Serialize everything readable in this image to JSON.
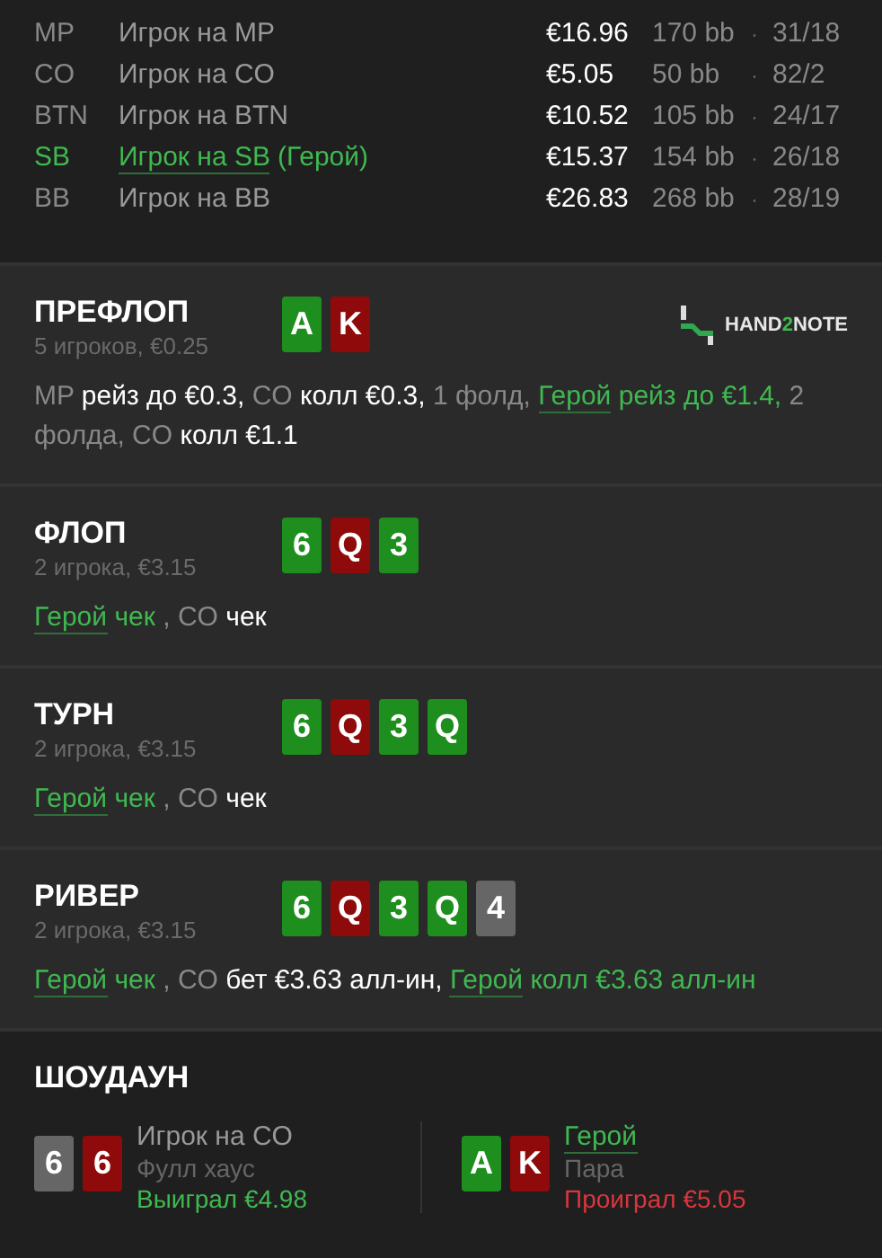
{
  "players": [
    {
      "position": "MP",
      "name": "Игрок на MP",
      "hero": false,
      "stack": "€16.96",
      "bb": "170 bb",
      "stats": "31/18"
    },
    {
      "position": "CO",
      "name": "Игрок на CO",
      "hero": false,
      "stack": "€5.05",
      "bb": "50 bb",
      "stats": "82/2"
    },
    {
      "position": "BTN",
      "name": "Игрок на BTN",
      "hero": false,
      "stack": "€10.52",
      "bb": "105 bb",
      "stats": "24/17"
    },
    {
      "position": "SB",
      "name": "Игрок на SB",
      "hero": true,
      "hero_label": "(Герой)",
      "stack": "€15.37",
      "bb": "154 bb",
      "stats": "26/18"
    },
    {
      "position": "BB",
      "name": "Игрок на BB",
      "hero": false,
      "stack": "€26.83",
      "bb": "268 bb",
      "stats": "28/19"
    }
  ],
  "separator": "·",
  "logo": {
    "prefix": "HAND",
    "accent": "2",
    "suffix": "NOTE"
  },
  "streets": [
    {
      "title": "ПРЕФЛОП",
      "info": "5 игроков, €0.25",
      "logo": true,
      "cards": [
        {
          "rank": "A",
          "color": "#1e8f1e"
        },
        {
          "rank": "K",
          "color": "#8f0a0a"
        }
      ],
      "actions": [
        {
          "kind": "player",
          "text": "MP"
        },
        {
          "kind": "action",
          "text": "рейз до €0.3,"
        },
        {
          "kind": "player",
          "text": "CO"
        },
        {
          "kind": "action",
          "text": "колл €0.3,"
        },
        {
          "kind": "player",
          "text": "1 фолд,"
        },
        {
          "kind": "hero",
          "text": "Герой"
        },
        {
          "kind": "hero_action",
          "text": "рейз до €1.4,"
        },
        {
          "kind": "player",
          "text": "2 фолда,"
        },
        {
          "kind": "player",
          "text": "CO"
        },
        {
          "kind": "action",
          "text": "колл €1.1"
        }
      ]
    },
    {
      "title": "ФЛОП",
      "info": "2 игрока, €3.15",
      "logo": false,
      "cards": [
        {
          "rank": "6",
          "color": "#1e8f1e"
        },
        {
          "rank": "Q",
          "color": "#8f0a0a"
        },
        {
          "rank": "3",
          "color": "#1e8f1e"
        }
      ],
      "actions": [
        {
          "kind": "hero",
          "text": "Герой"
        },
        {
          "kind": "hero_action",
          "text": "чек"
        },
        {
          "kind": "player",
          "text": ", CO"
        },
        {
          "kind": "action",
          "text": "чек"
        }
      ]
    },
    {
      "title": "ТУРН",
      "info": "2 игрока, €3.15",
      "logo": false,
      "cards": [
        {
          "rank": "6",
          "color": "#1e8f1e"
        },
        {
          "rank": "Q",
          "color": "#8f0a0a"
        },
        {
          "rank": "3",
          "color": "#1e8f1e"
        },
        {
          "rank": "Q",
          "color": "#1e8f1e"
        }
      ],
      "actions": [
        {
          "kind": "hero",
          "text": "Герой"
        },
        {
          "kind": "hero_action",
          "text": "чек"
        },
        {
          "kind": "player",
          "text": ", CO"
        },
        {
          "kind": "action",
          "text": "чек"
        }
      ]
    },
    {
      "title": "РИВЕР",
      "info": "2 игрока, €3.15",
      "logo": false,
      "cards": [
        {
          "rank": "6",
          "color": "#1e8f1e"
        },
        {
          "rank": "Q",
          "color": "#8f0a0a"
        },
        {
          "rank": "3",
          "color": "#1e8f1e"
        },
        {
          "rank": "Q",
          "color": "#1e8f1e"
        },
        {
          "rank": "4",
          "color": "#666666"
        }
      ],
      "actions": [
        {
          "kind": "hero",
          "text": "Герой"
        },
        {
          "kind": "hero_action",
          "text": "чек"
        },
        {
          "kind": "player",
          "text": ", CO"
        },
        {
          "kind": "action",
          "text": "бет €3.63 алл-ин,"
        },
        {
          "kind": "hero",
          "text": "Герой"
        },
        {
          "kind": "hero_action",
          "text": "колл €3.63 алл-ин"
        }
      ]
    }
  ],
  "showdown": {
    "title": "ШОУДАУН",
    "results": [
      {
        "name": "Игрок на CO",
        "hero": false,
        "cards": [
          {
            "rank": "6",
            "color": "#666666"
          },
          {
            "rank": "6",
            "color": "#8f0a0a"
          }
        ],
        "hand": "Фулл хаус",
        "result": "Выиграл €4.98",
        "won": true
      },
      {
        "name": "Герой",
        "hero": true,
        "cards": [
          {
            "rank": "A",
            "color": "#1e8f1e"
          },
          {
            "rank": "K",
            "color": "#8f0a0a"
          }
        ],
        "hand": "Пара",
        "result": "Проиграл €5.05",
        "won": false
      }
    ]
  }
}
